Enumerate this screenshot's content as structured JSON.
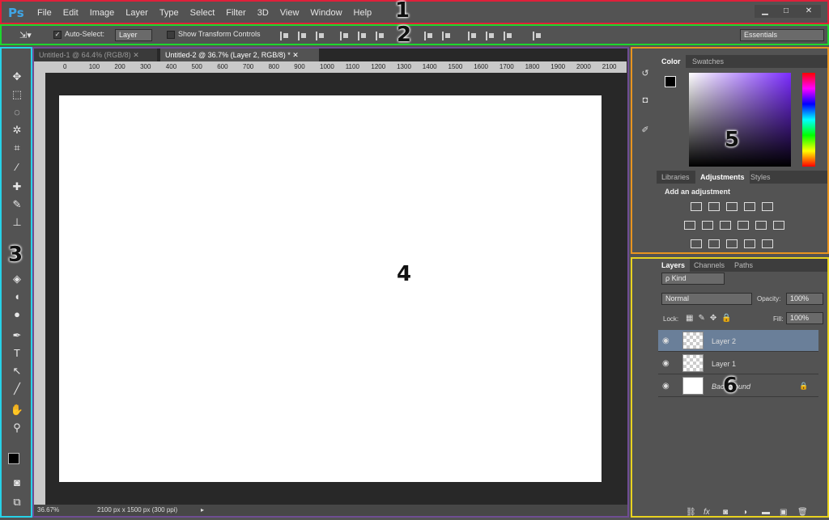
{
  "app": {
    "logo": "Ps",
    "menus": [
      "File",
      "Edit",
      "Image",
      "Layer",
      "Type",
      "Select",
      "Filter",
      "3D",
      "View",
      "Window",
      "Help"
    ],
    "window_buttons": [
      "▁",
      "□",
      "✕"
    ]
  },
  "options": {
    "auto_select_label": "Auto-Select:",
    "auto_select_value": "Layer",
    "transform_label": "Show Transform Controls",
    "workspace": "Essentials"
  },
  "tabs": [
    {
      "label": "Untitled-1 @ 64.4% (RGB/8)"
    },
    {
      "label": "Untitled-2 @ 36.7% (Layer 2, RGB/8) *"
    }
  ],
  "ruler_ticks": [
    "0",
    "100",
    "200",
    "300",
    "400",
    "500",
    "600",
    "700",
    "800",
    "900",
    "1000",
    "1100",
    "1200",
    "1300",
    "1400",
    "1500",
    "1600",
    "1700",
    "1800",
    "1900",
    "2000",
    "2100"
  ],
  "status": {
    "zoom": "36.67%",
    "doc_size": "2100 px x 1500 px (300 ppi)"
  },
  "color_panel": {
    "tabs": [
      "Color",
      "Swatches"
    ],
    "lower_tabs": [
      "Libraries",
      "Adjustments",
      "Styles"
    ],
    "adjust_heading": "Add an adjustment"
  },
  "layers_panel": {
    "tabs": [
      "Layers",
      "Channels",
      "Paths"
    ],
    "kind_filter": "ρ Kind",
    "blend_mode": "Normal",
    "opacity_label": "Opacity:",
    "opacity_value": "100%",
    "lock_label": "Lock:",
    "fill_label": "Fill:",
    "fill_value": "100%",
    "layers": [
      {
        "name": "Layer 2"
      },
      {
        "name": "Layer 1"
      },
      {
        "name": "Background"
      }
    ]
  },
  "badges": [
    "1",
    "2",
    "3",
    "4",
    "5",
    "6"
  ],
  "colors": {
    "menubar_border": "#e0203a",
    "options_border": "#1ed62e",
    "tools_border": "#26d2e8",
    "doc_border": "#6f4d93",
    "color_border": "#e8941f",
    "layers_border": "#e8d21f",
    "selected_layer": "#6a7f99"
  }
}
